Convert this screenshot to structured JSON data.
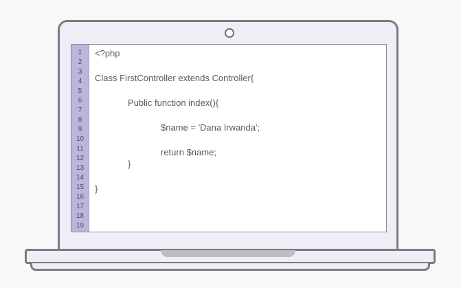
{
  "editor": {
    "line_numbers": [
      "1",
      "2",
      "3",
      "4",
      "5",
      "6",
      "7",
      "8",
      "9",
      "10",
      "11",
      "12",
      "13",
      "14",
      "15",
      "16",
      "17",
      "18",
      "19"
    ],
    "code": {
      "line1": "<?php",
      "line4": "Class FirstController extends Controller{",
      "line6": "Public function index(){",
      "line9": "$name = 'Dana Irwanda';",
      "line11": "return $name;",
      "line13": "}",
      "line15": "}"
    }
  },
  "colors": {
    "gutter": "#bbb7dc",
    "frame": "#7a7a80",
    "lid": "#efedf6",
    "code_text": "#5a5a5a"
  },
  "icons": {
    "webcam": "webcam-icon"
  }
}
